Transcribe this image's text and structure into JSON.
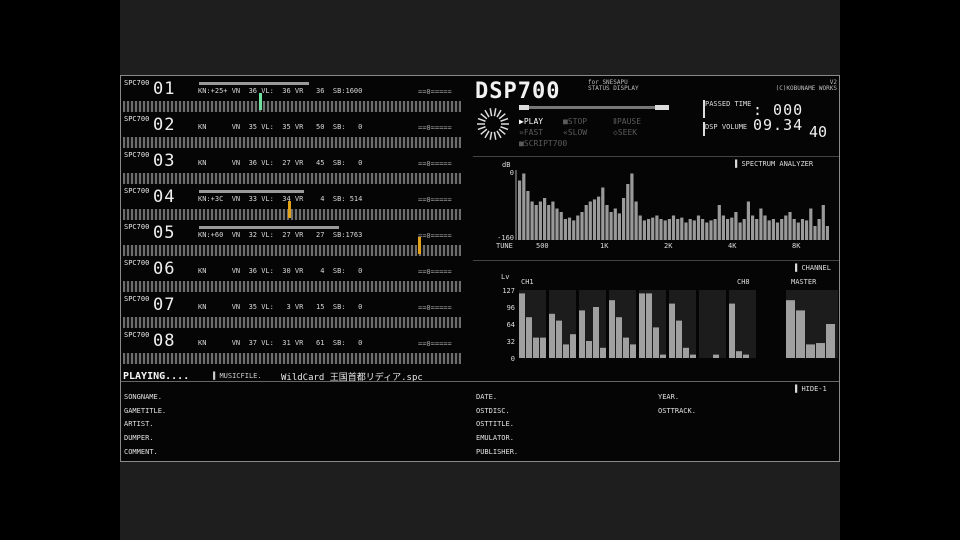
{
  "app": {
    "logo": "DSP700",
    "logo_sub_1": "for SNESAPU",
    "logo_sub_2": "STATUS DISPLAY",
    "right_title_1": "V2",
    "right_title_2": "(C)KOBUNAME WORKS"
  },
  "tracks": [
    {
      "label": "SPC700",
      "num": "01",
      "stats": "KN:+25+ VN  36 VL:  36 VR   36  SB:1600"
    },
    {
      "label": "SPC700",
      "num": "02",
      "stats": "KN      VN  35 VL:  35 VR   50  SB:   0"
    },
    {
      "label": "SPC700",
      "num": "03",
      "stats": "KN      VN  36 VL:  27 VR   45  SB:   0"
    },
    {
      "label": "SPC700",
      "num": "04",
      "stats": "KN:+3C  VN  33 VL:  34 VR    4  SB: 514"
    },
    {
      "label": "SPC700",
      "num": "05",
      "stats": "KN:+60  VN  32 VL:  27 VR   27  SB:1763"
    },
    {
      "label": "SPC700",
      "num": "06",
      "stats": "KN      VN  36 VL:  30 VR    4  SB:   0"
    },
    {
      "label": "SPC700",
      "num": "07",
      "stats": "KN      VN  35 VL:   3 VR   15  SB:   0"
    },
    {
      "label": "SPC700",
      "num": "08",
      "stats": "KN      VN  37 VL:  31 VR   61  SB:   0"
    }
  ],
  "controls": {
    "play": "PLAY",
    "stop": "STOP",
    "pause": "PAUSE",
    "fast": "FAST",
    "slow": "SLOW",
    "seek": "SEEK",
    "script700": "SCRIPT700"
  },
  "passed_label": "PASSED TIME",
  "passed_time": ": 000 09.34",
  "volume_label": "DSP VOLUME",
  "volume_value": "40",
  "spectrum": {
    "title": "SPECTRUM ANALYZER",
    "db_label": "dB",
    "top": "0",
    "bottom": "-160",
    "tune_label": "TUNE",
    "x_ticks": [
      "500",
      "1K",
      "2K",
      "4K",
      "8K"
    ],
    "values": [
      0.85,
      0.95,
      0.7,
      0.55,
      0.5,
      0.55,
      0.6,
      0.5,
      0.55,
      0.45,
      0.4,
      0.3,
      0.32,
      0.28,
      0.35,
      0.4,
      0.5,
      0.55,
      0.58,
      0.62,
      0.75,
      0.5,
      0.4,
      0.45,
      0.38,
      0.6,
      0.8,
      0.95,
      0.55,
      0.35,
      0.28,
      0.3,
      0.32,
      0.35,
      0.3,
      0.28,
      0.3,
      0.35,
      0.3,
      0.32,
      0.25,
      0.3,
      0.28,
      0.35,
      0.3,
      0.25,
      0.28,
      0.3,
      0.5,
      0.35,
      0.3,
      0.32,
      0.4,
      0.25,
      0.3,
      0.55,
      0.35,
      0.3,
      0.45,
      0.35,
      0.28,
      0.3,
      0.25,
      0.3,
      0.35,
      0.4,
      0.3,
      0.25,
      0.3,
      0.28,
      0.45,
      0.2,
      0.3,
      0.5,
      0.2
    ]
  },
  "channel": {
    "title": "CHANNEL",
    "lv_label": "Lv",
    "ch1_label": "CH1",
    "ch8_label": "CH8",
    "master_label": "MASTER",
    "y_ticks": [
      "127",
      "96",
      "64",
      "32",
      "0"
    ],
    "channels": [
      {
        "bars": [
          0.95,
          0.6,
          0.3,
          0.3
        ]
      },
      {
        "bars": [
          0.65,
          0.55,
          0.2,
          0.35
        ]
      },
      {
        "bars": [
          0.7,
          0.25,
          0.75,
          0.15
        ]
      },
      {
        "bars": [
          0.85,
          0.6,
          0.3,
          0.2
        ]
      },
      {
        "bars": [
          0.95,
          0.95,
          0.45,
          0.05
        ]
      },
      {
        "bars": [
          0.8,
          0.55,
          0.15,
          0.05
        ]
      },
      {
        "bars": [
          0,
          0,
          0.05,
          0
        ]
      },
      {
        "bars": [
          0.8,
          0.1,
          0.05,
          0
        ]
      }
    ],
    "master": [
      0.85,
      0.7,
      0.2,
      0.22,
      0.5
    ]
  },
  "status": {
    "playing": "PLAYING....",
    "file_label": "MUSICFILE.",
    "file_name": "WildCard_王国首都リディア.spc",
    "hide_label": "HIDE-1"
  },
  "info_labels": {
    "songname": "SONGNAME.",
    "gametitle": "GAMETITLE.",
    "artist": "ARTIST.",
    "dumper": "DUMPER.",
    "comment": "COMMENT.",
    "date": "DATE.",
    "ostdisc": "OSTDISC.",
    "osttitle": "OSTTITLE.",
    "emulator": "EMULATOR.",
    "publisher": "PUBLISHER.",
    "year": "YEAR.",
    "osttrack": "OSTTRACK."
  }
}
